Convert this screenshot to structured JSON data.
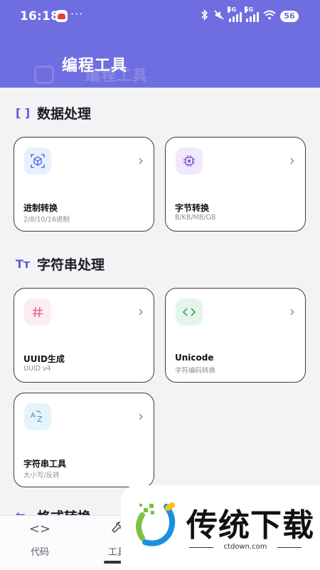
{
  "status_bar": {
    "time": "16:18",
    "more": "···",
    "network_label_1": "5G",
    "network_label_2": "5G",
    "battery": "56"
  },
  "header": {
    "title": "编程工具",
    "title_ghost": "编程工具"
  },
  "sections": [
    {
      "icon": "[ ]",
      "title": "数据处理",
      "cards": [
        {
          "name": "进制转换",
          "desc": "2/8/10/16进制",
          "icon": "cube-scan-icon",
          "chevron": "›"
        },
        {
          "name": "字节转换",
          "desc": "B/KB/MB/GB",
          "icon": "chip-icon",
          "chevron": "›"
        }
      ]
    },
    {
      "icon": "Tт",
      "title": "字符串处理",
      "cards": [
        {
          "name": "UUID生成",
          "desc": "UUID v4",
          "icon": "hash-icon",
          "chevron": "›"
        },
        {
          "name": "Unicode",
          "desc": "字符编码转换",
          "icon": "code-brackets-icon",
          "chevron": "›"
        },
        {
          "name": "字符串工具",
          "desc": "大小写/反转",
          "icon": "sort-az-icon",
          "chevron": "›"
        }
      ]
    },
    {
      "title": "格式转换"
    }
  ],
  "bottom_nav": [
    {
      "label": "代码",
      "icon": "<>"
    },
    {
      "label": "工具",
      "icon": "wrench-icon"
    }
  ],
  "watermark": {
    "brand": "传统下载",
    "url": "ctdown.com"
  },
  "colors": {
    "header": "#6f6ee0",
    "accent": "#5b5bd6",
    "background": "#f3f3f6",
    "card_border": "#3c3c44"
  }
}
